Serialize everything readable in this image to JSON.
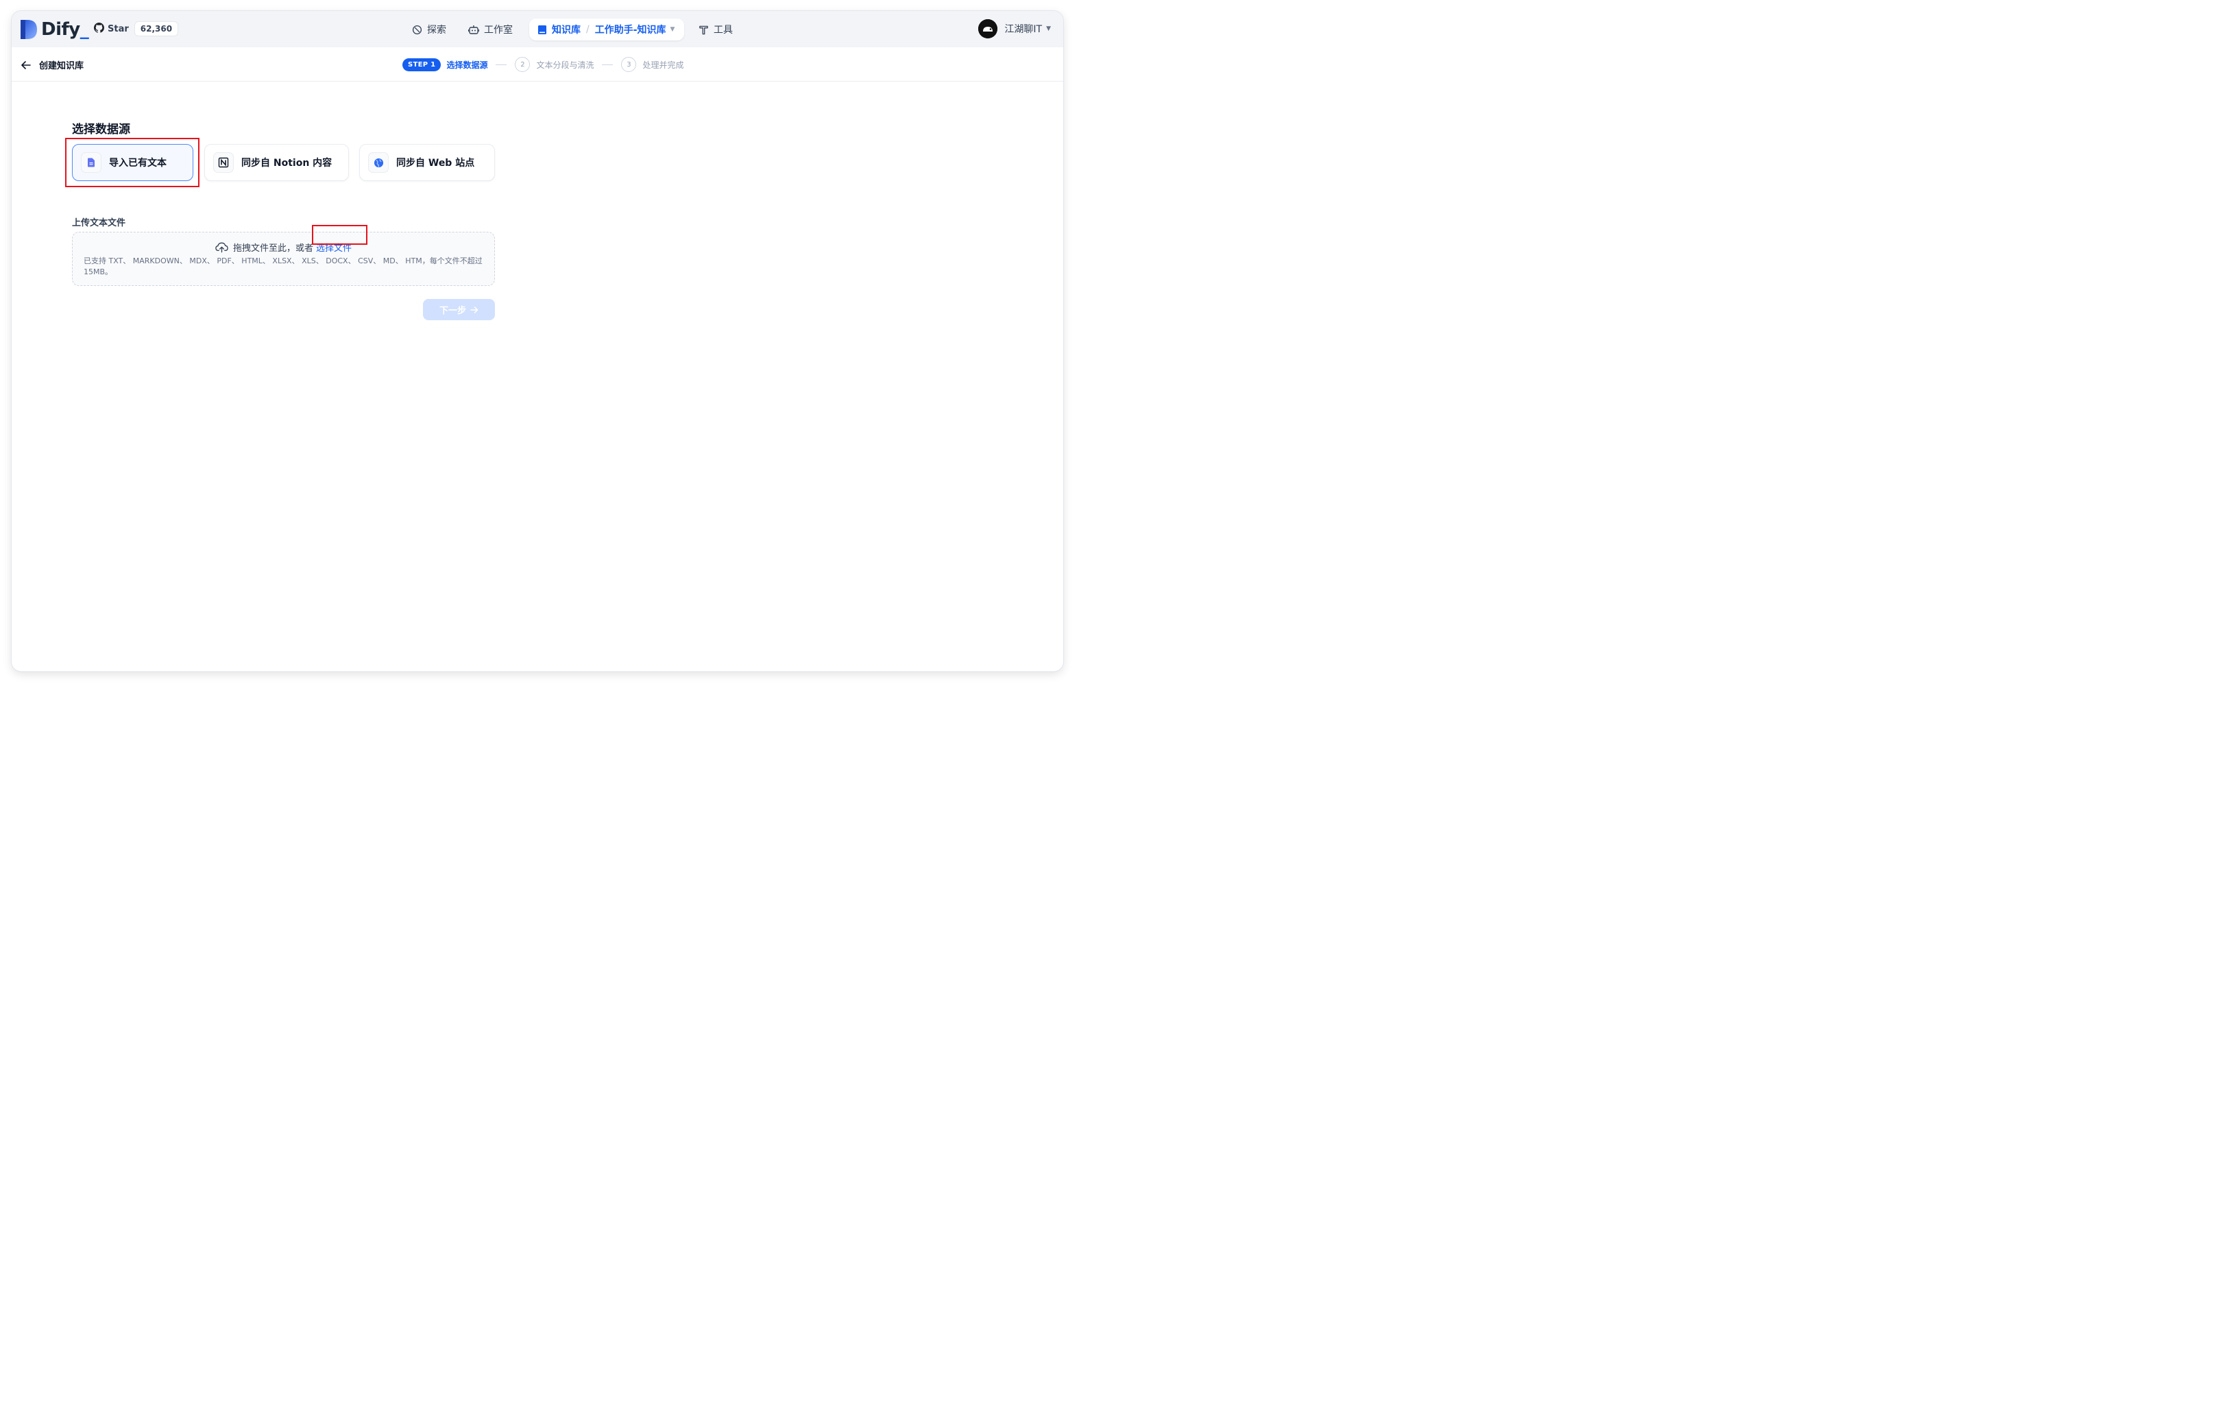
{
  "app": {
    "logo_text": "Dify",
    "logo_suffix": "_"
  },
  "github": {
    "star_label": "Star",
    "star_count": "62,360"
  },
  "nav": {
    "explore": "探索",
    "studio": "工作室",
    "knowledge": "知识库",
    "knowledge_separator": "/",
    "current_dataset": "工作助手-知识库",
    "tools": "工具"
  },
  "user": {
    "name": "江湖聊IT"
  },
  "subheader": {
    "back_label": "创建知识库",
    "steps": [
      {
        "badge": "STEP 1",
        "label": "选择数据源",
        "state": "active"
      },
      {
        "number": "2",
        "label": "文本分段与清洗",
        "state": "pending"
      },
      {
        "number": "3",
        "label": "处理并完成",
        "state": "pending"
      }
    ]
  },
  "main": {
    "section_title": "选择数据源",
    "sources": [
      {
        "label": "导入已有文本",
        "icon": "file-icon",
        "selected": true
      },
      {
        "label": "同步自 Notion 内容",
        "icon": "notion-icon",
        "selected": false
      },
      {
        "label": "同步自 Web 站点",
        "icon": "globe-icon",
        "selected": false
      }
    ],
    "upload_label": "上传文本文件",
    "dropzone": {
      "text": "拖拽文件至此，或者",
      "pick_link": "选择文件",
      "hint": "已支持 TXT、 MARKDOWN、 MDX、 PDF、 HTML、 XLSX、 XLS、 DOCX、 CSV、 MD、 HTM，每个文件不超过 15MB。"
    },
    "next_button": "下一步"
  },
  "colors": {
    "accent": "#155eef",
    "highlight_annotation": "#e5131d",
    "next_button_disabled": "#d1e0ff",
    "header_bg": "#f2f4f7"
  }
}
